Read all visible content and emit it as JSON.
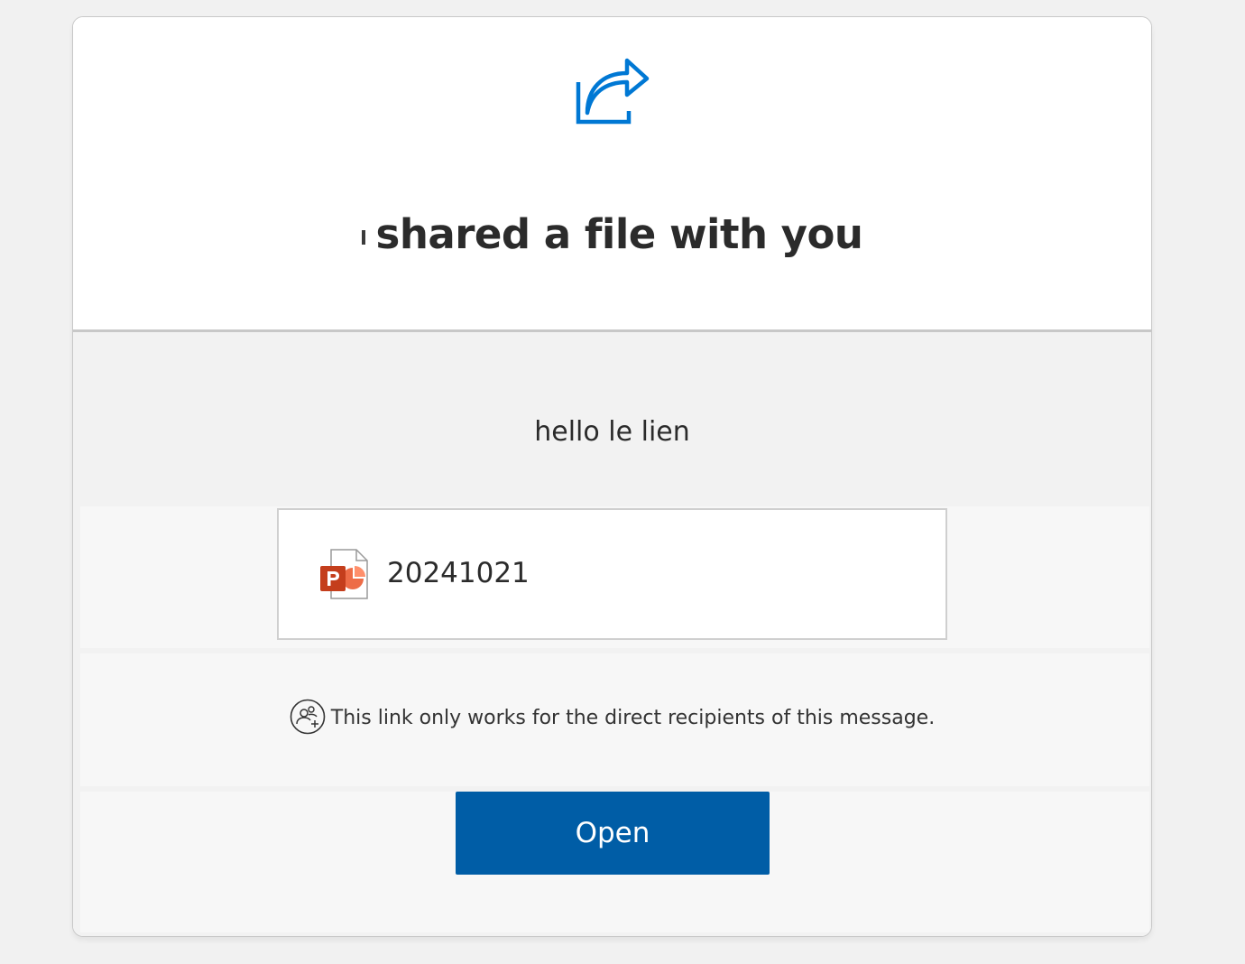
{
  "header": {
    "title": "shared a file with you",
    "icon": "share-icon"
  },
  "message": "hello le lien",
  "file": {
    "name": "20241021",
    "icon": "powerpoint-file-icon"
  },
  "notice": {
    "text": "This link only works for the direct recipients of this message.",
    "icon": "people-icon"
  },
  "actions": {
    "open_label": "Open"
  },
  "colors": {
    "accent": "#005da6",
    "share_icon": "#0078d4",
    "powerpoint": "#c43e1c"
  }
}
